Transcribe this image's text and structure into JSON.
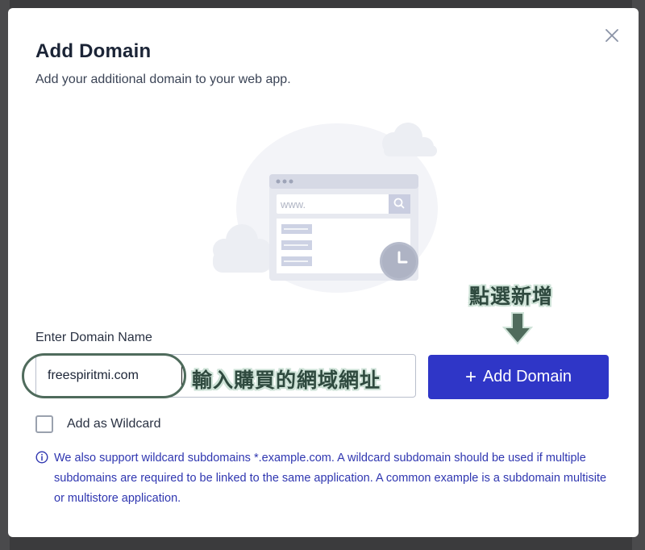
{
  "modal": {
    "title": "Add Domain",
    "subtitle": "Add your additional domain to your web app.",
    "close_icon": "close-icon"
  },
  "illustration": {
    "url_text": "www."
  },
  "form": {
    "domain_label": "Enter Domain Name",
    "domain_value": "freespiritmi.com",
    "add_button_label": "+ Add Domain",
    "add_button_text": "Add Domain",
    "wildcard_label": "Add as Wildcard",
    "wildcard_checked": false,
    "info_text": "We also support wildcard subdomains *.example.com. A wildcard subdomain should be used if multiple subdomains are required to be linked to the same application. A common example is a subdomain multisite or multistore application."
  },
  "annotations": {
    "input_note": "輸入購買的網域網址",
    "button_note": "點選新增"
  },
  "colors": {
    "primary": "#2f36c7",
    "info_text": "#2f36b0",
    "annotation": "#2f4a3f"
  }
}
